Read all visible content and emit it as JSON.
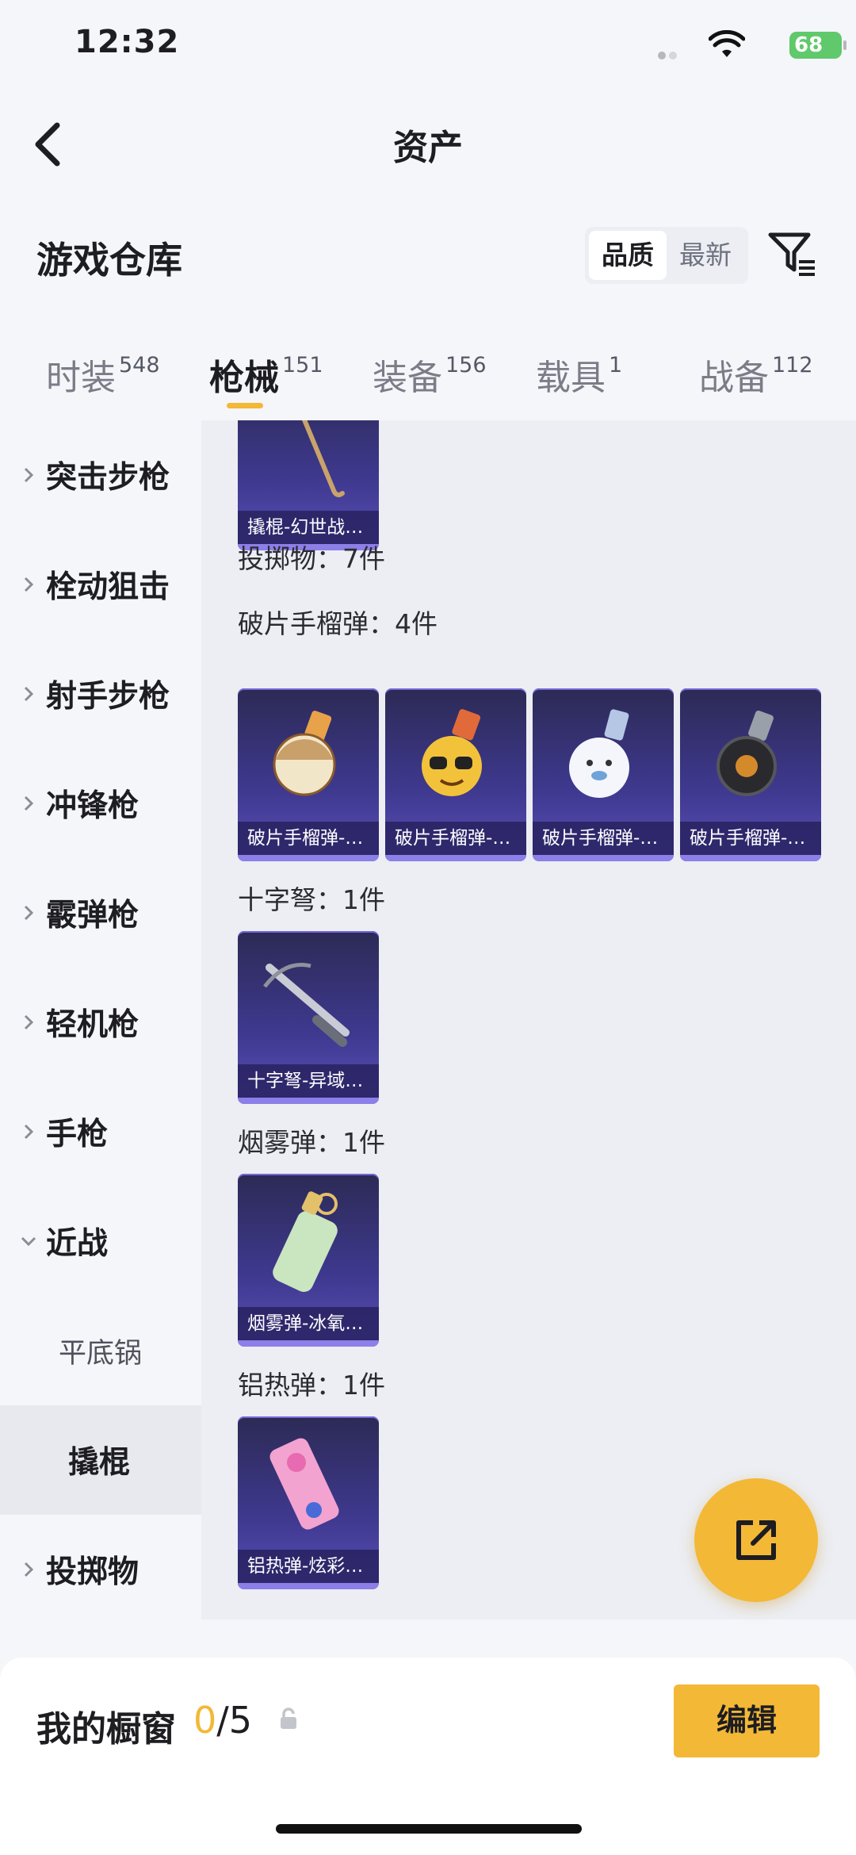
{
  "status_bar": {
    "time": "12:32",
    "battery": "68"
  },
  "header": {
    "title": "资产"
  },
  "warehouse": {
    "title": "游戏仓库",
    "sort_options": [
      "品质",
      "最新"
    ],
    "sort_active": "品质"
  },
  "tabs": [
    {
      "label": "时装",
      "count": "548"
    },
    {
      "label": "枪械",
      "count": "151",
      "active": true
    },
    {
      "label": "装备",
      "count": "156"
    },
    {
      "label": "载具",
      "count": "1"
    },
    {
      "label": "战备",
      "count": "112"
    }
  ],
  "sidebar": {
    "items": [
      {
        "label": "突击步枪"
      },
      {
        "label": "栓动狙击"
      },
      {
        "label": "射手步枪"
      },
      {
        "label": "冲锋枪"
      },
      {
        "label": "霰弹枪"
      },
      {
        "label": "轻机枪"
      },
      {
        "label": "手枪"
      },
      {
        "label": "近战",
        "expanded": true
      },
      {
        "label": "平底锅",
        "sub": true
      },
      {
        "label": "撬棍",
        "sub": true,
        "selected": true
      },
      {
        "label": "投掷物"
      }
    ]
  },
  "content": {
    "top_card": {
      "caption": "撬棍-幻世战…"
    },
    "throwables_header": "投掷物：7件",
    "groups": [
      {
        "title": "破片手榴弹：4件",
        "cards": [
          "破片手榴弹-…",
          "破片手榴弹-…",
          "破片手榴弹-…",
          "破片手榴弹-…"
        ]
      },
      {
        "title": "十字弩：1件",
        "cards": [
          "十字弩-异域…"
        ]
      },
      {
        "title": "烟雾弹：1件",
        "cards": [
          "烟雾弹-冰氧…"
        ]
      },
      {
        "title": "铝热弹：1件",
        "cards": [
          "铝热弹-炫彩…"
        ]
      }
    ]
  },
  "showcase": {
    "title": "我的橱窗",
    "current": "0",
    "total": "/5",
    "edit_label": "编辑"
  },
  "colors": {
    "accent": "#f3b836",
    "card_bg": "#3f3990",
    "battery": "#5fc96b"
  }
}
